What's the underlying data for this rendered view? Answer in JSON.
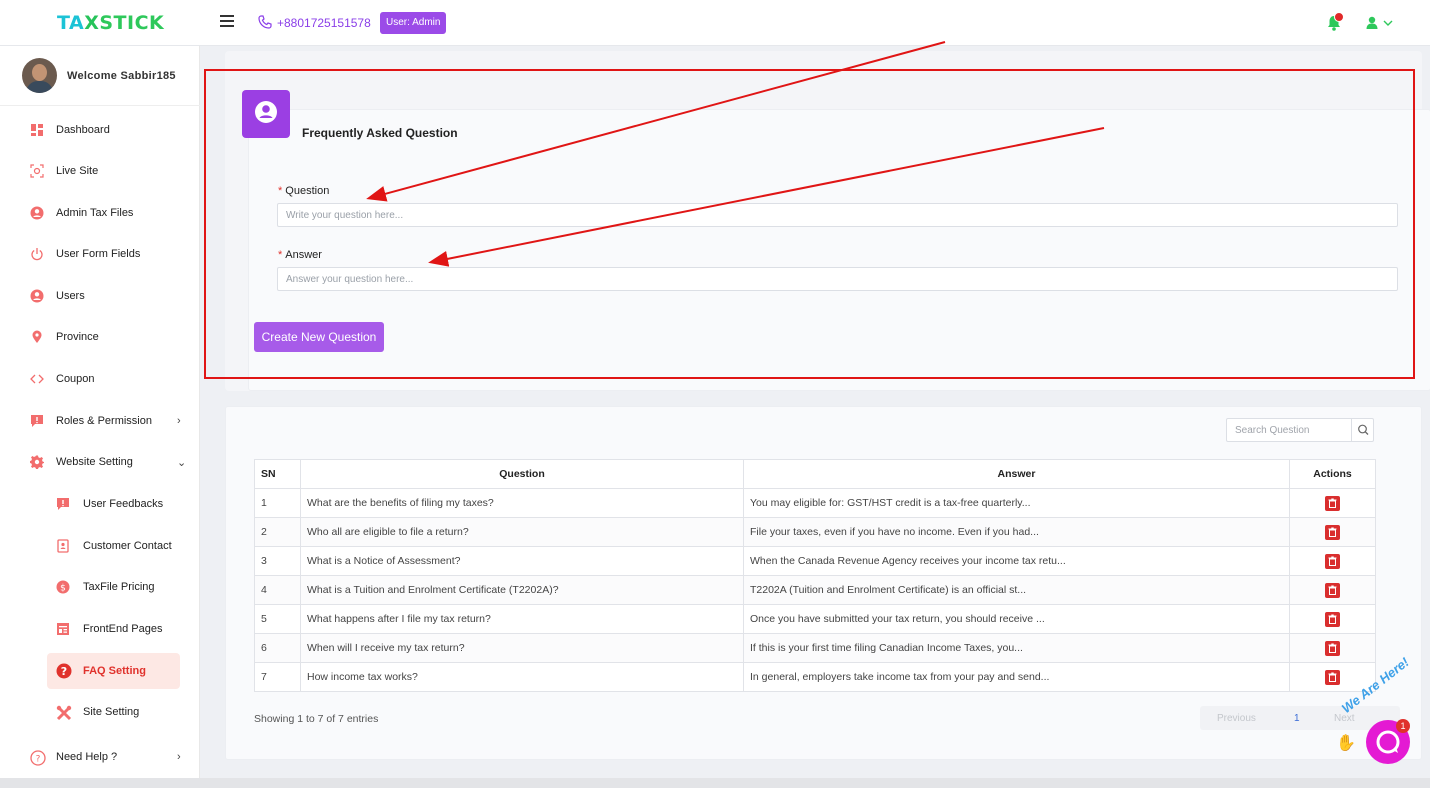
{
  "brand": {
    "logo_a": "TA",
    "logo_b": "X",
    "logo_c": "STICK"
  },
  "header": {
    "phone": "+8801725151578",
    "role_badge": "User: Admin"
  },
  "sidebar": {
    "welcome": "Welcome Sabbir185",
    "items": [
      {
        "label": "Dashboard",
        "icon": "dashboard-icon"
      },
      {
        "label": "Live Site",
        "icon": "live-site-icon"
      },
      {
        "label": "Admin Tax Files",
        "icon": "user-circle-icon"
      },
      {
        "label": "User Form Fields",
        "icon": "power-icon"
      },
      {
        "label": "Users",
        "icon": "user-circle-icon"
      },
      {
        "label": "Province",
        "icon": "location-pin-icon"
      },
      {
        "label": "Coupon",
        "icon": "code-icon"
      },
      {
        "label": "Roles & Permission",
        "icon": "alert-message-icon"
      },
      {
        "label": "Website Setting",
        "icon": "gear-icon"
      },
      {
        "label": "User Feedbacks",
        "icon": "feedback-icon"
      },
      {
        "label": "Customer Contact",
        "icon": "contact-icon"
      },
      {
        "label": "TaxFile Pricing",
        "icon": "dollar-icon"
      },
      {
        "label": "FrontEnd Pages",
        "icon": "pages-icon"
      },
      {
        "label": "FAQ Setting",
        "icon": "question-icon"
      },
      {
        "label": "Site Setting",
        "icon": "tools-icon"
      },
      {
        "label": "Need Help ?",
        "icon": "help-icon"
      }
    ]
  },
  "faq_form": {
    "title": "Frequently Asked Question",
    "question_label": "Question",
    "question_placeholder": "Write your question here...",
    "answer_label": "Answer",
    "answer_placeholder": "Answer your question here...",
    "submit_label": "Create New Question"
  },
  "faq_table": {
    "search_placeholder": "Search Question",
    "columns": [
      "SN",
      "Question",
      "Answer",
      "Actions"
    ],
    "rows": [
      {
        "sn": "1",
        "question": "What are the benefits of filing my taxes?",
        "answer": "You may eligible for: GST/HST credit is a tax-free quarterly..."
      },
      {
        "sn": "2",
        "question": "Who all are eligible to file a return?",
        "answer": "File your taxes, even if you have no income. Even if you had..."
      },
      {
        "sn": "3",
        "question": "What is a Notice of Assessment?",
        "answer": "When the Canada Revenue Agency receives your income tax retu..."
      },
      {
        "sn": "4",
        "question": "What is a Tuition and Enrolment Certificate (T2202A)?",
        "answer": "T2202A (Tuition and Enrolment Certificate) is an official st..."
      },
      {
        "sn": "5",
        "question": "What happens after I file my tax return?",
        "answer": "Once you have submitted your tax return, you should receive ..."
      },
      {
        "sn": "6",
        "question": "When will I receive my tax return?",
        "answer": "If this is your first time filing Canadian Income Taxes, you..."
      },
      {
        "sn": "7",
        "question": "How income tax works?",
        "answer": "In general, employers take income tax from your pay and send..."
      }
    ],
    "showing": "Showing 1 to 7 of 7 entries",
    "pager": {
      "prev": "Previous",
      "page": "1",
      "next": "Next"
    }
  },
  "chat": {
    "tagline": "We Are Here!",
    "badge": "1"
  },
  "colors": {
    "accent": "#9b3fe3",
    "active_red": "#e0322c",
    "annotation_red": "#e01515"
  }
}
